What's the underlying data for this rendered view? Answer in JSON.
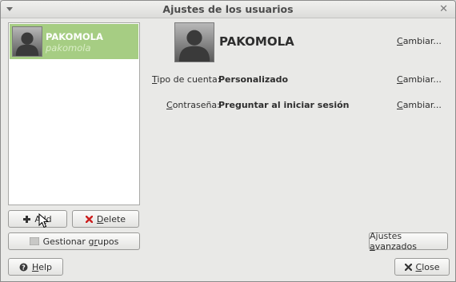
{
  "window": {
    "title": "Ajustes de los usuarios"
  },
  "user_list": {
    "items": [
      {
        "display_name": "PAKOMOLA",
        "login": "pakomola",
        "selected": true
      }
    ]
  },
  "user_buttons": {
    "add": {
      "prefix": "A",
      "underlined": "d",
      "suffix": "d"
    },
    "delete": {
      "prefix": "",
      "underlined": "D",
      "suffix": "elete"
    },
    "groups": {
      "prefix": "Gestionar g",
      "underlined": "r",
      "suffix": "upos"
    }
  },
  "details": {
    "name": "PAKOMOLA",
    "change_name": {
      "underlined": "C",
      "suffix": "ambiar..."
    },
    "account_type": {
      "label_underlined": "T",
      "label_suffix": "ipo de cuenta:",
      "value": "Personalizado",
      "change": {
        "underlined": "C",
        "suffix": "ambiar..."
      }
    },
    "password": {
      "label_underlined": "C",
      "label_suffix": "ontraseña:",
      "value": "Preguntar al iniciar sesión",
      "change": {
        "underlined": "C",
        "suffix": "ambiar..."
      }
    }
  },
  "advanced_button": {
    "prefix": "Ajustes ",
    "underlined": "a",
    "suffix": "vanzados"
  },
  "footer": {
    "help": {
      "underlined": "H",
      "suffix": "elp"
    },
    "close": {
      "underlined": "C",
      "suffix": "lose"
    }
  },
  "colors": {
    "selection": "#a6cd83",
    "window_bg": "#e9e9e7",
    "delete_icon": "#cc1f1f"
  },
  "icons": [
    "menu-arrow-icon",
    "close-icon",
    "user-avatar-icon",
    "plus-icon",
    "delete-x-icon",
    "group-icon",
    "help-icon",
    "close-x-icon",
    "mouse-pointer-icon"
  ]
}
